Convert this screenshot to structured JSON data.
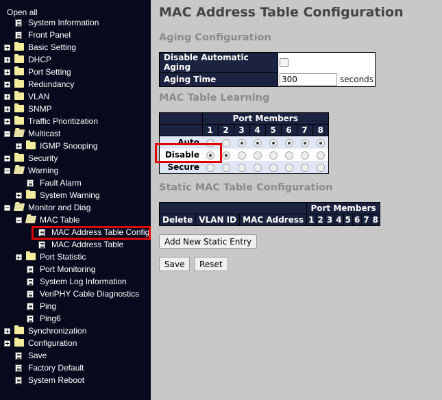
{
  "sidebar": {
    "open_all": "Open all",
    "items": [
      {
        "label": "System Information",
        "type": "doc",
        "level": 0
      },
      {
        "label": "Front Panel",
        "type": "doc",
        "level": 0
      },
      {
        "label": "Basic Setting",
        "type": "folder",
        "level": 0,
        "state": "collapsed"
      },
      {
        "label": "DHCP",
        "type": "folder",
        "level": 0,
        "state": "collapsed"
      },
      {
        "label": "Port Setting",
        "type": "folder",
        "level": 0,
        "state": "collapsed"
      },
      {
        "label": "Redundancy",
        "type": "folder",
        "level": 0,
        "state": "collapsed"
      },
      {
        "label": "VLAN",
        "type": "folder",
        "level": 0,
        "state": "collapsed"
      },
      {
        "label": "SNMP",
        "type": "folder",
        "level": 0,
        "state": "collapsed"
      },
      {
        "label": "Traffic Prioritization",
        "type": "folder",
        "level": 0,
        "state": "collapsed"
      },
      {
        "label": "Multicast",
        "type": "folder",
        "level": 0,
        "state": "expanded"
      },
      {
        "label": "IGMP Snooping",
        "type": "folder",
        "level": 1,
        "state": "collapsed"
      },
      {
        "label": "Security",
        "type": "folder",
        "level": 0,
        "state": "collapsed"
      },
      {
        "label": "Warning",
        "type": "folder",
        "level": 0,
        "state": "expanded"
      },
      {
        "label": "Fault Alarm",
        "type": "doc",
        "level": 1
      },
      {
        "label": "System Warning",
        "type": "folder",
        "level": 1,
        "state": "collapsed"
      },
      {
        "label": "Monitor and Diag",
        "type": "folder",
        "level": 0,
        "state": "expanded"
      },
      {
        "label": "MAC Table",
        "type": "folder",
        "level": 1,
        "state": "expanded"
      },
      {
        "label": "MAC Address Table Configuration",
        "type": "doc",
        "level": 2,
        "selected": true
      },
      {
        "label": "MAC Address Table",
        "type": "doc",
        "level": 2
      },
      {
        "label": "Port Statistic",
        "type": "folder",
        "level": 1,
        "state": "collapsed"
      },
      {
        "label": "Port Monitoring",
        "type": "doc",
        "level": 1
      },
      {
        "label": "System Log Information",
        "type": "doc",
        "level": 1
      },
      {
        "label": "VeriPHY Cable Diagnostics",
        "type": "doc",
        "level": 1
      },
      {
        "label": "Ping",
        "type": "doc",
        "level": 1
      },
      {
        "label": "Ping6",
        "type": "doc",
        "level": 1
      },
      {
        "label": "Synchronization",
        "type": "folder",
        "level": 0,
        "state": "collapsed"
      },
      {
        "label": "Configuration",
        "type": "folder",
        "level": 0,
        "state": "collapsed"
      },
      {
        "label": "Save",
        "type": "doc",
        "level": 0
      },
      {
        "label": "Factory Default",
        "type": "doc",
        "level": 0
      },
      {
        "label": "System Reboot",
        "type": "doc",
        "level": 0
      }
    ]
  },
  "main": {
    "title": "MAC Address Table Configuration",
    "aging": {
      "heading": "Aging Configuration",
      "disable_label": "Disable Automatic Aging",
      "disable_checked": false,
      "time_label": "Aging Time",
      "time_value": "300",
      "time_unit": "seconds"
    },
    "learning": {
      "heading": "MAC Table Learning",
      "port_members_label": "Port Members",
      "ports": [
        "1",
        "2",
        "3",
        "4",
        "5",
        "6",
        "7",
        "8"
      ],
      "rows": [
        {
          "label": "Auto",
          "selected": [
            false,
            false,
            true,
            true,
            true,
            true,
            true,
            true
          ]
        },
        {
          "label": "Disable",
          "selected": [
            true,
            true,
            false,
            false,
            false,
            false,
            false,
            false
          ]
        },
        {
          "label": "Secure",
          "selected": [
            false,
            false,
            false,
            false,
            false,
            false,
            false,
            false
          ]
        }
      ]
    },
    "static": {
      "heading": "Static MAC Table Configuration",
      "port_members_label": "Port Members",
      "columns": [
        "Delete",
        "VLAN ID",
        "MAC Address"
      ],
      "ports": [
        "1",
        "2",
        "3",
        "4",
        "5",
        "6",
        "7",
        "8"
      ],
      "add_button": "Add New Static Entry"
    },
    "buttons": {
      "save": "Save",
      "reset": "Reset"
    }
  }
}
